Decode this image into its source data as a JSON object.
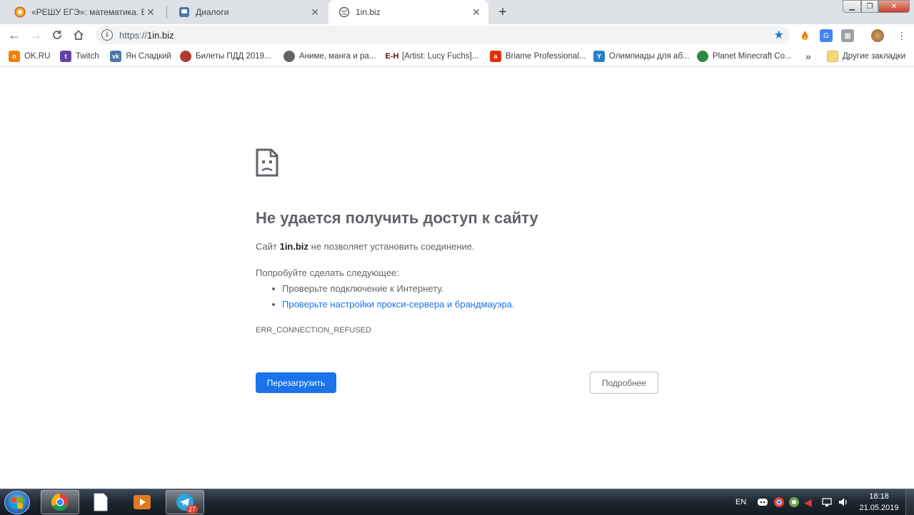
{
  "tabs": [
    {
      "label": "«РЕШУ ЕГЭ»: математика. ЕГЭ —",
      "icon": "sun-logo-icon",
      "active": false
    },
    {
      "label": "Диалоги",
      "icon": "chat-icon",
      "active": false
    },
    {
      "label": "1in.biz",
      "icon": "globe-icon",
      "active": true
    }
  ],
  "toolbar": {
    "url_scheme": "https://",
    "url_host": "1in.biz"
  },
  "bookmarks": [
    {
      "label": "OK.RU",
      "icon": "ok-icon",
      "color": "#ee8208"
    },
    {
      "label": "Twitch",
      "icon": "twitch-icon",
      "color": "#6441a5"
    },
    {
      "label": "Ян Сладкий",
      "icon": "vk-icon",
      "color": "#4a76a8"
    },
    {
      "label": "Билеты ПДД 2019...",
      "icon": "pdd-icon",
      "color": "#b03a2e"
    },
    {
      "label": "Аниме, манга и ра...",
      "icon": "globe-icon",
      "color": "#5f6368"
    },
    {
      "label": "[Artist: Lucy Fuchs]...",
      "icon": "eh-icon",
      "color": "#660611"
    },
    {
      "label": "Briame Professional...",
      "icon": "aliexpress-icon",
      "color": "#e62e04"
    },
    {
      "label": "Олимпиады для аб...",
      "icon": "olymp-icon",
      "color": "#2a7fc8"
    },
    {
      "label": "Planet Minecraft Co...",
      "icon": "planet-icon",
      "color": "#2b8a3e"
    }
  ],
  "bookmarks_more": "»",
  "other_bookmarks": "Другие закладки",
  "error": {
    "title": "Не удается получить доступ к сайту",
    "sub_prefix": "Сайт ",
    "sub_host": "1in.biz",
    "sub_suffix": " не позволяет установить соединение.",
    "try_heading": "Попробуйте сделать следующее:",
    "suggestions": [
      "Проверьте подключение к Интернету.",
      "Проверьте настройки прокси-сервера и брандмауэра."
    ],
    "code": "ERR_CONNECTION_REFUSED",
    "reload_label": "Перезагрузить",
    "details_label": "Подробнее"
  },
  "taskbar": {
    "telegram_badge": "27",
    "lang": "EN",
    "time": "18:18",
    "date": "21.05.2019"
  },
  "colors": {
    "accent": "#1a73e8",
    "text_secondary": "#5f6368"
  }
}
